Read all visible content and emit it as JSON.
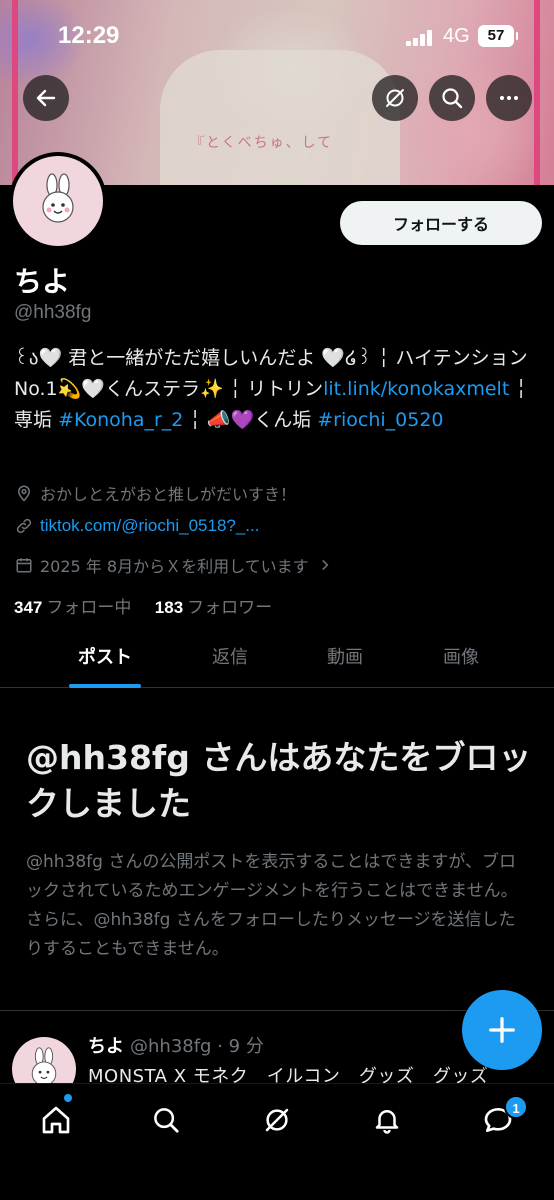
{
  "status_bar": {
    "time": "12:29",
    "network": "4G",
    "battery": "57"
  },
  "banner": {
    "caption": "『とくべちゅ、して"
  },
  "profile": {
    "name": "ちよ",
    "handle": "@hh38fg",
    "follow_label": "フォローする",
    "bio": {
      "part1": "꒰ა🤍 君と一緒がただ嬉しいんだよ 🤍໒꒱ ╎ ハイテンションNo.1💫🤍くんステラ✨ ╎ リトリン",
      "link1": "lit.link/konokaxmelt",
      "part2": " ╎ 専垢 ",
      "tag1": "#Konoha_r_2",
      "part3": " ╎ 📣💜くん垢 ",
      "tag2": "#riochi_0520"
    },
    "location": "おかしとえがおと推しがだいすき！",
    "website": "tiktok.com/@riochi_0518?_...",
    "joined": "2025 年 8月からＸを利用しています",
    "following_count": "347",
    "following_label": "フォロー中",
    "followers_count": "183",
    "followers_label": "フォロワー"
  },
  "tabs": [
    {
      "label": "ポスト",
      "active": true
    },
    {
      "label": "返信"
    },
    {
      "label": "動画"
    },
    {
      "label": "画像"
    }
  ],
  "blocked": {
    "title": "@hh38fg さんはあなたをブロックしました",
    "body": "@hh38fg さんの公開ポストを表示することはできますが、ブロックされているためエンゲージメントを行うことはできません。さらに、@hh38fg さんをフォローしたりメッセージを送信したりすることもできません。"
  },
  "post": {
    "author": "ちよ",
    "meta": "@hh38fg · 9 分",
    "text": "MONSTA X モネク　イルコン　グッズ　グッズ"
  },
  "nav": {
    "messages_badge": "1"
  },
  "colors": {
    "accent": "#1d9bf0",
    "background": "#000000",
    "muted": "#71767b",
    "banner_pink": "#ef4f8a"
  },
  "icons": [
    "back-arrow-icon",
    "grok-icon",
    "search-icon",
    "more-icon",
    "location-icon",
    "link-icon",
    "calendar-icon",
    "chevron-right-icon",
    "compose-plus-icon",
    "home-icon",
    "notifications-icon",
    "messages-icon"
  ]
}
